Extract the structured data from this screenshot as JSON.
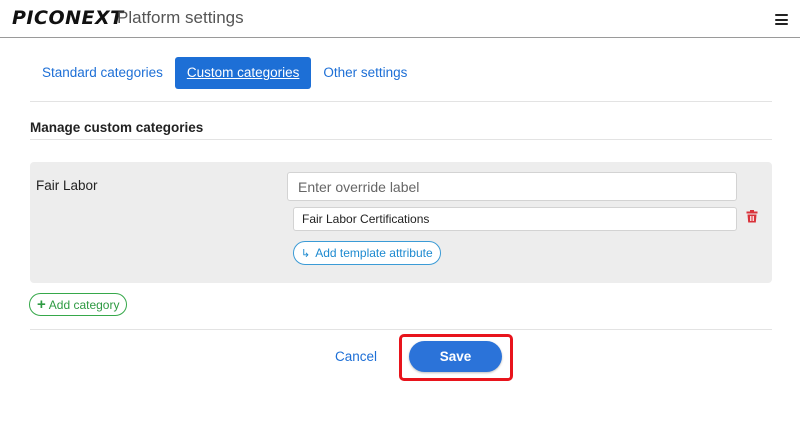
{
  "header": {
    "logo_text": "PICONEXT",
    "title": "Platform settings",
    "menu_icon": "hamburger-menu-icon"
  },
  "tabs": [
    {
      "label": "Standard categories",
      "active": false
    },
    {
      "label": "Custom categories",
      "active": true
    },
    {
      "label": "Other settings",
      "active": false
    }
  ],
  "section": {
    "title": "Manage custom categories"
  },
  "categories": [
    {
      "name": "Fair Labor",
      "override_placeholder": "Enter override label",
      "override_value": "",
      "attribute_value": "Fair Labor Certifications",
      "delete_icon": "trash-icon",
      "add_attribute_label": "Add template attribute",
      "add_attribute_icon": "return-arrow-icon"
    }
  ],
  "actions": {
    "add_category_label": "Add category",
    "add_category_icon": "plus-icon",
    "cancel_label": "Cancel",
    "save_label": "Save"
  },
  "colors": {
    "accent": "#1d6fd6",
    "save_button": "#2b73d9",
    "add_category": "#2e9a42",
    "delete": "#d9323a",
    "highlight": "#e8141c"
  }
}
